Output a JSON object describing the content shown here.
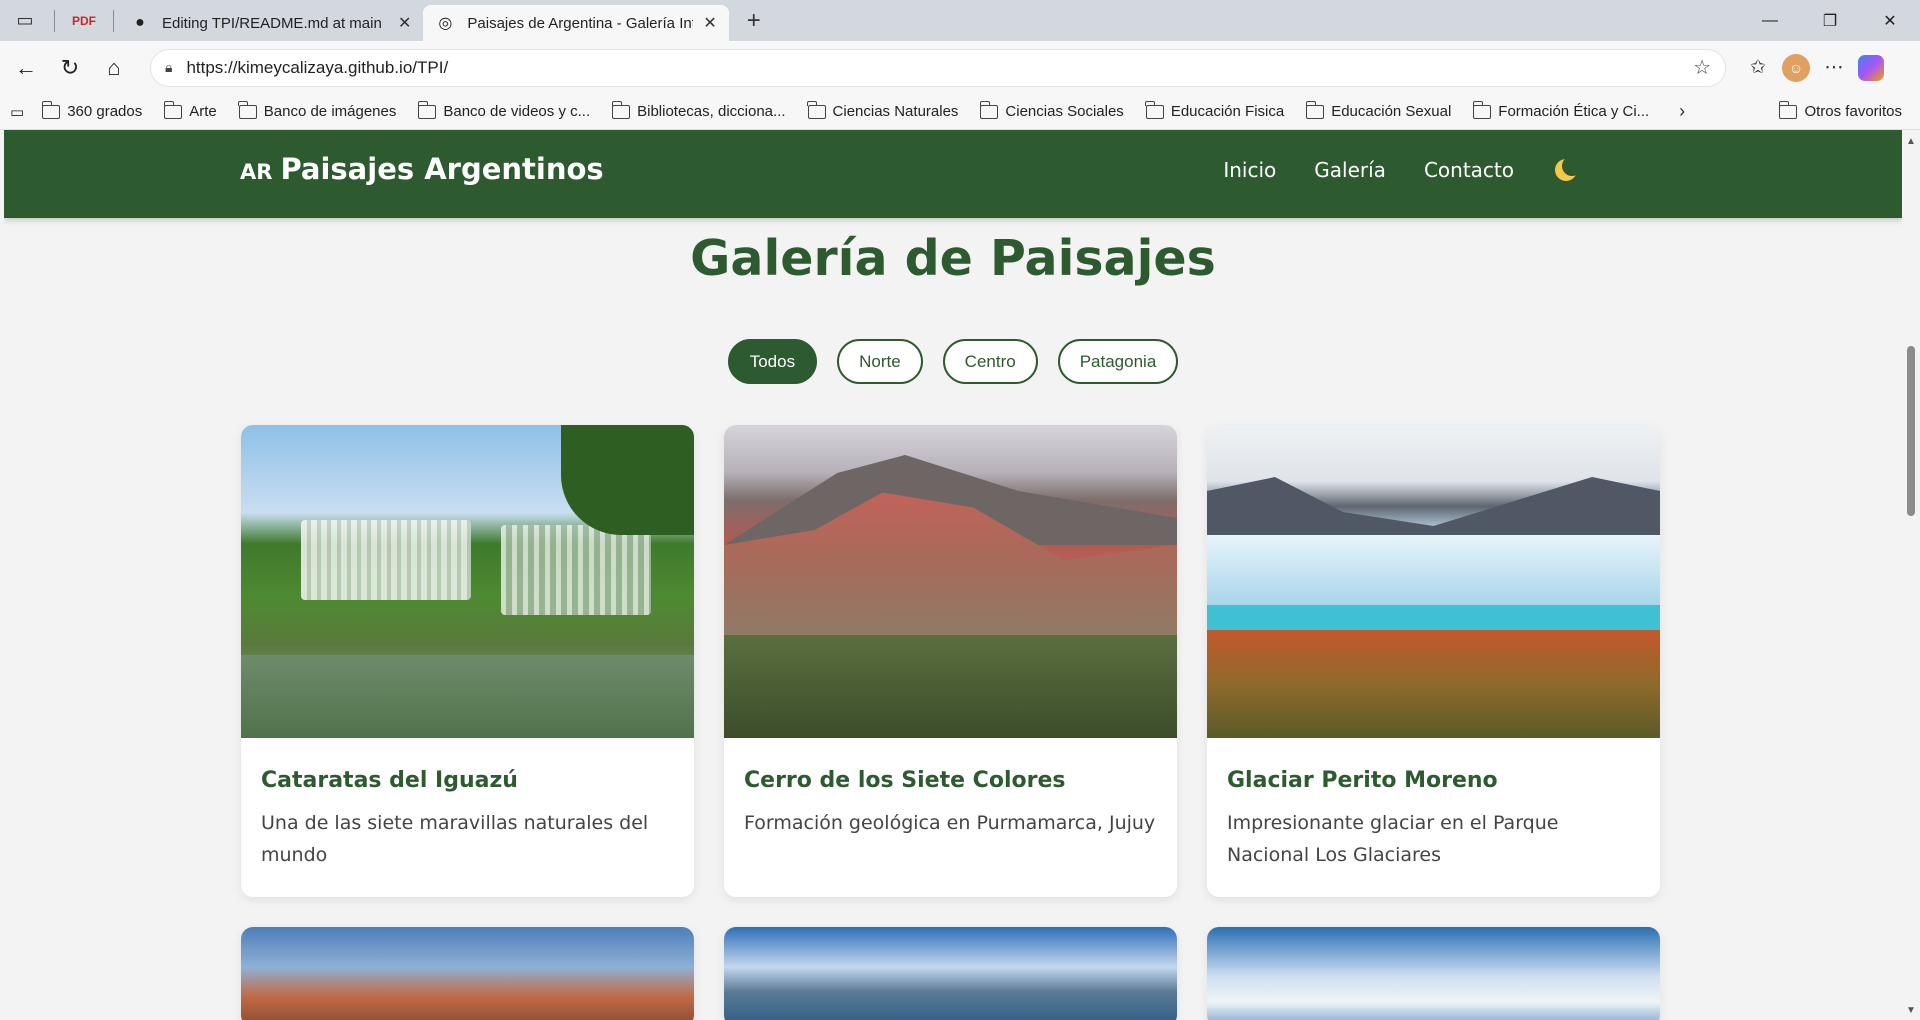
{
  "browser": {
    "tabs": [
      {
        "title": "Editing TPI/README.md at main",
        "active": false,
        "icon": "github-icon"
      },
      {
        "title": "Paisajes de Argentina - Galería Int",
        "active": true,
        "icon": "globe-icon"
      }
    ],
    "url": "https://kimeycalizaya.github.io/TPI/",
    "favorites": [
      "360 grados",
      "Arte",
      "Banco de imágenes",
      "Banco de videos y c...",
      "Bibliotecas, dicciona...",
      "Ciencias Naturales",
      "Ciencias Sociales",
      "Educación Fisica",
      "Educación Sexual",
      "Formación Ética y Ci..."
    ],
    "other_favorites": "Otros favoritos"
  },
  "site": {
    "brand_flag": "AR",
    "brand_name": "Paisajes Argentinos",
    "nav": [
      "Inicio",
      "Galería",
      "Contacto"
    ],
    "accent_color": "#2d5a2f"
  },
  "gallery": {
    "title": "Galería de Paisajes",
    "filters": [
      "Todos",
      "Norte",
      "Centro",
      "Patagonia"
    ],
    "active_filter": "Todos",
    "cards": [
      {
        "title": "Cataratas del Iguazú",
        "description": "Una de las siete maravillas naturales del mundo"
      },
      {
        "title": "Cerro de los Siete Colores",
        "description": "Formación geológica en Purmamarca, Jujuy"
      },
      {
        "title": "Glaciar Perito Moreno",
        "description": "Impresionante glaciar en el Parque Nacional Los Glaciares"
      }
    ]
  }
}
